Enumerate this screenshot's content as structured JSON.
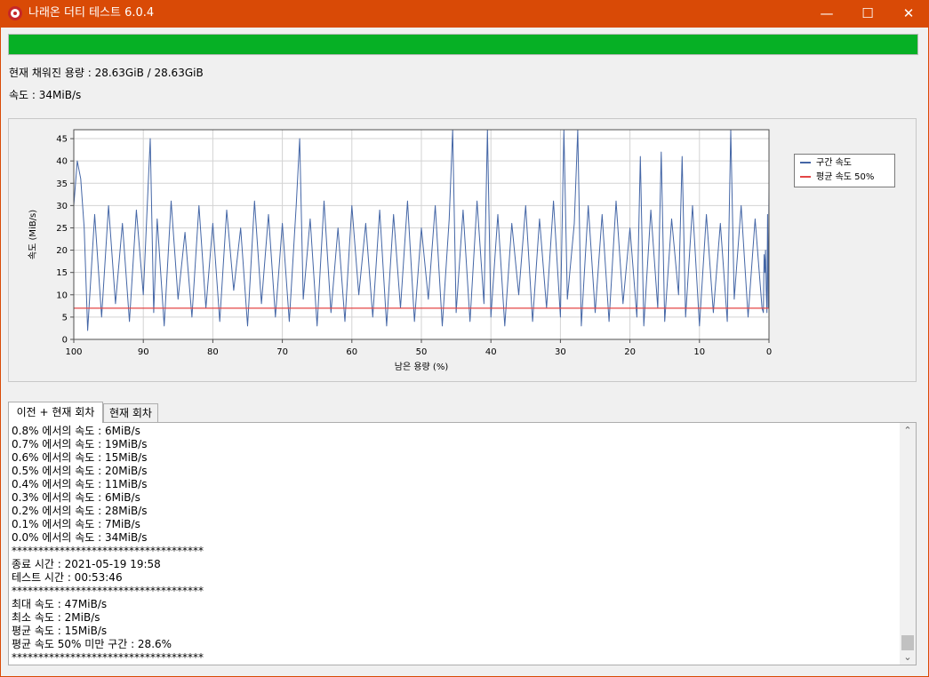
{
  "window": {
    "title": "나래온 더티 테스트 6.0.4",
    "minimize_glyph": "—",
    "maximize_glyph": "☐",
    "close_glyph": "✕",
    "app_icon": "naraeon-logo-icon",
    "frame_color": "#d94a06"
  },
  "progress": {
    "fraction": 1.0,
    "color": "#06b025"
  },
  "status": {
    "capacity_text": "현재 채워진 용량 : 28.63GiB / 28.63GiB",
    "speed_text": "속도 : 34MiB/s"
  },
  "chart_data": {
    "type": "line",
    "xlabel": "남은 용량 (%)",
    "ylabel": "속도 (MiB/s)",
    "xlim": [
      100,
      0
    ],
    "ylim": [
      0,
      47
    ],
    "x_ticks": [
      100,
      90,
      80,
      70,
      60,
      50,
      40,
      30,
      20,
      10,
      0
    ],
    "y_ticks": [
      0,
      5,
      10,
      15,
      20,
      25,
      30,
      35,
      40,
      45
    ],
    "grid": true,
    "legend_position": "right",
    "series": [
      {
        "name": "구간 속도",
        "color": "#4466a6",
        "x": [
          100,
          99.5,
          99,
          98.5,
          98,
          97,
          96,
          95,
          94,
          93,
          92,
          91,
          90,
          89,
          88.5,
          88,
          87,
          86,
          85,
          84,
          83,
          82,
          81,
          80,
          79,
          78,
          77,
          76,
          75,
          74,
          73,
          72,
          71,
          70,
          69,
          68,
          67.5,
          67,
          66,
          65,
          64,
          63,
          62,
          61,
          60,
          59,
          58,
          57,
          56,
          55,
          54,
          53,
          52,
          51,
          50,
          49,
          48,
          47,
          46,
          45.5,
          45,
          44,
          43,
          42,
          41,
          40.5,
          40,
          39,
          38,
          37,
          36,
          35,
          34,
          33,
          32,
          31,
          30,
          29.5,
          29,
          28,
          27.5,
          27,
          26,
          25,
          24,
          23,
          22,
          21,
          20,
          19,
          18.5,
          18,
          17,
          16,
          15.5,
          15,
          14,
          13,
          12.5,
          12,
          11,
          10,
          9,
          8,
          7,
          6,
          5.5,
          5,
          4,
          3,
          2,
          1,
          0.8,
          0.7,
          0.6,
          0.5,
          0.4,
          0.3,
          0.2,
          0.1,
          0.0
        ],
        "y": [
          30,
          40,
          36,
          25,
          2,
          28,
          5,
          30,
          8,
          26,
          4,
          29,
          10,
          45,
          6,
          27,
          3,
          31,
          9,
          24,
          5,
          30,
          7,
          26,
          4,
          29,
          11,
          25,
          3,
          31,
          8,
          28,
          5,
          26,
          4,
          30,
          45,
          9,
          27,
          3,
          31,
          6,
          25,
          4,
          30,
          10,
          26,
          5,
          29,
          3,
          28,
          7,
          31,
          4,
          25,
          9,
          30,
          3,
          27,
          47,
          6,
          29,
          4,
          31,
          8,
          47,
          5,
          28,
          3,
          26,
          10,
          30,
          4,
          27,
          7,
          31,
          5,
          47,
          9,
          26,
          47,
          3,
          30,
          6,
          28,
          4,
          31,
          8,
          25,
          5,
          41,
          3,
          29,
          7,
          42,
          4,
          27,
          10,
          41,
          5,
          30,
          3,
          28,
          6,
          26,
          4,
          47,
          9,
          30,
          5,
          27,
          7,
          6,
          19,
          15,
          20,
          11,
          6,
          28,
          7,
          34
        ]
      },
      {
        "name": "평균 속도 50%",
        "color": "#e34646",
        "x": [
          100,
          0
        ],
        "y": [
          7,
          7
        ]
      }
    ]
  },
  "tabs": [
    {
      "label": "이전 + 현재 회차",
      "active": true
    },
    {
      "label": "현재 회차",
      "active": false
    }
  ],
  "log": {
    "lines": [
      "0.8% 에서의 속도 : 6MiB/s",
      "0.7% 에서의 속도 : 19MiB/s",
      "0.6% 에서의 속도 : 15MiB/s",
      "0.5% 에서의 속도 : 20MiB/s",
      "0.4% 에서의 속도 : 11MiB/s",
      "0.3% 에서의 속도 : 6MiB/s",
      "0.2% 에서의 속도 : 28MiB/s",
      "0.1% 에서의 속도 : 7MiB/s",
      "0.0% 에서의 속도 : 34MiB/s",
      "************************************",
      "종료 시간 : 2021-05-19 19:58",
      "테스트 시간 : 00:53:46",
      "************************************",
      "최대 속도 : 47MiB/s",
      "최소 속도 : 2MiB/s",
      "평균 속도 : 15MiB/s",
      "평균 속도 50% 미만 구간 : 28.6%",
      "************************************"
    ],
    "scroll_up_glyph": "⌃",
    "scroll_down_glyph": "⌄"
  }
}
